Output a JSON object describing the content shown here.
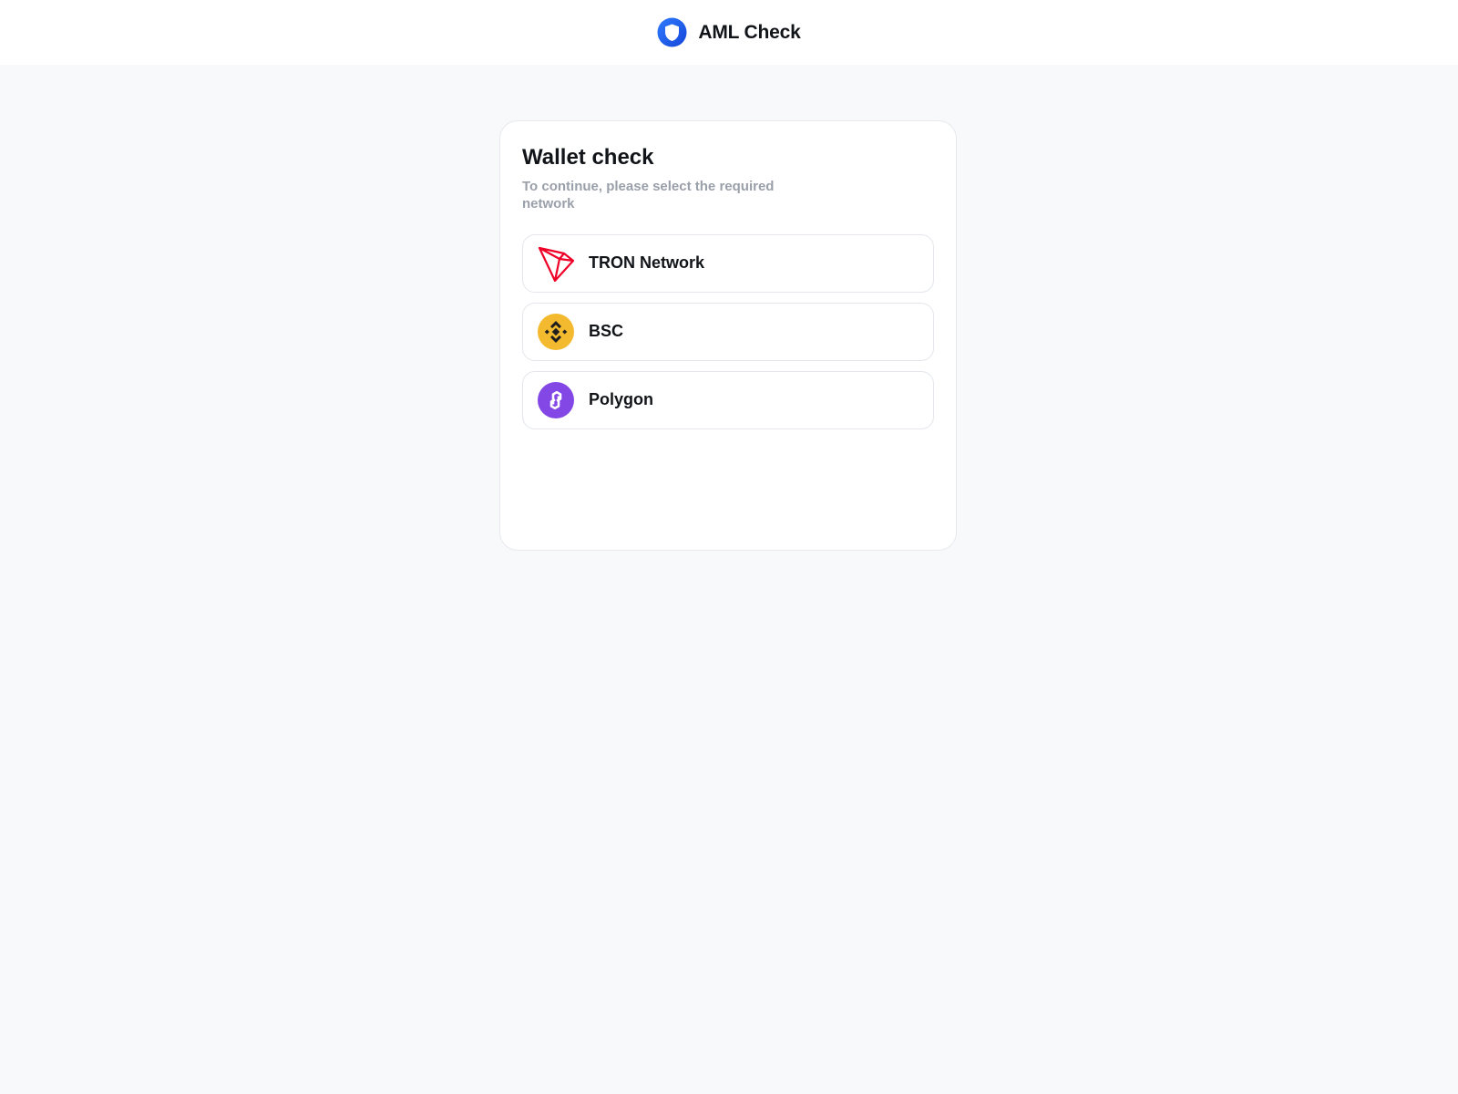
{
  "header": {
    "brand_name": "AML Check",
    "logo_icon": "shield-icon",
    "accent_color": "#1a56f0"
  },
  "card": {
    "title": "Wallet check",
    "subtitle": "To continue, please select the required network",
    "networks": [
      {
        "label": "TRON Network",
        "icon": "tron-icon",
        "color": "#ef0027"
      },
      {
        "label": "BSC",
        "icon": "bnb-icon",
        "color": "#f3ba2f"
      },
      {
        "label": "Polygon",
        "icon": "polygon-icon",
        "color": "#8247e5"
      }
    ]
  }
}
